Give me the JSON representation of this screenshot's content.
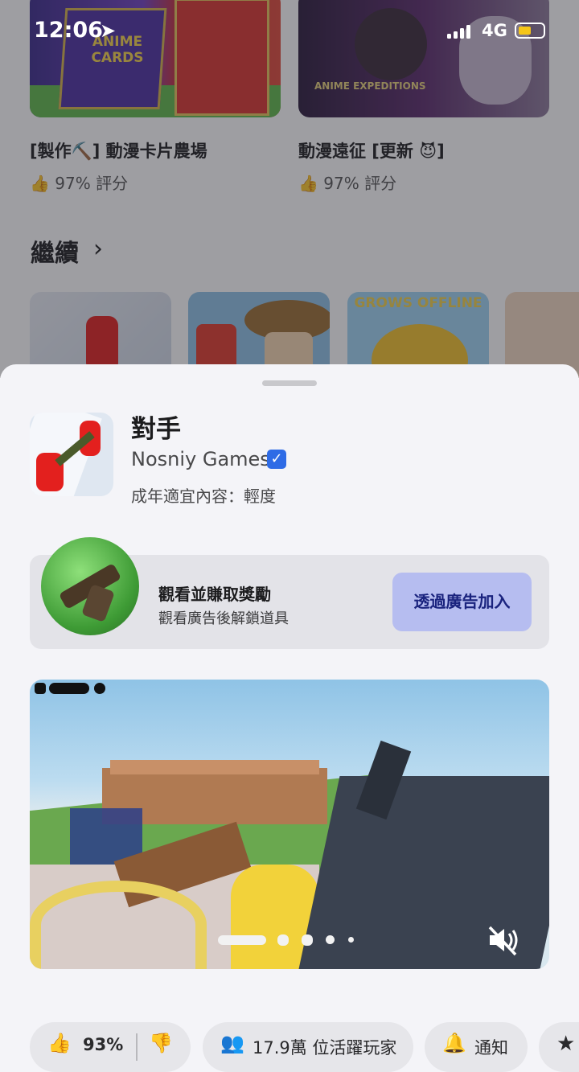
{
  "status_bar": {
    "time": "12:06",
    "network": "4G",
    "battery_color": "#f5c518"
  },
  "games": [
    {
      "title": "[製作⛏️] 動漫卡片農場",
      "rating": "97% 評分",
      "thumb_text": "ANIME CARDS"
    },
    {
      "title": "動漫遠征 [更新 😈]",
      "rating": "97% 評分",
      "thumb_text": "ANIME EXPEDITIONS"
    }
  ],
  "continue_section": {
    "title": "繼續",
    "tiles": [
      "",
      "",
      "GROWS OFFLINE",
      ""
    ]
  },
  "sheet": {
    "app_name": "對手",
    "developer": "Nosniy Games",
    "verified_mark": "✓",
    "maturity": "成年適宜內容：輕度",
    "reward": {
      "title": "觀看並賺取獎勵",
      "subtitle": "觀看廣告後解鎖道具",
      "button": "透過廣告加入"
    },
    "media": {
      "slide_count": 6,
      "active_slide": 1
    },
    "stats": {
      "like_percent": "93%",
      "active_players": "17.9萬 位活躍玩家",
      "notify": "通知"
    }
  },
  "colors": {
    "accent": "#b6bdf0",
    "accent_text": "#1a237e",
    "verified": "#2e6be6",
    "sheet_bg": "#f4f4f8"
  }
}
